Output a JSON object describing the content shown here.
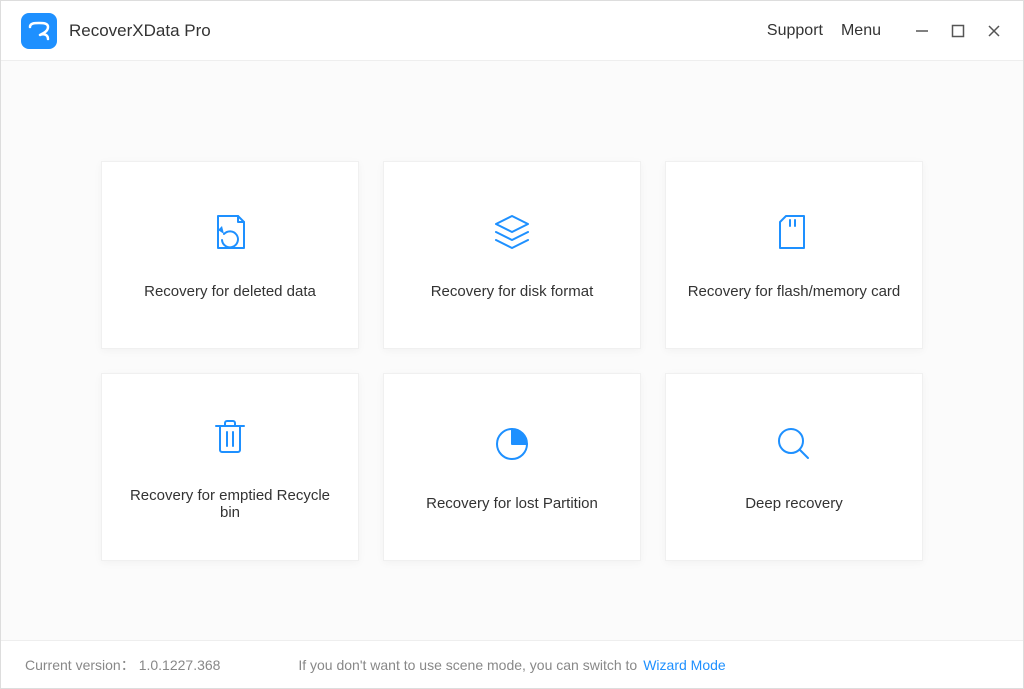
{
  "app": {
    "title": "RecoverXData Pro"
  },
  "header": {
    "support": "Support",
    "menu": "Menu"
  },
  "cards": [
    {
      "id": "deleted-data",
      "label": "Recovery for deleted data",
      "icon": "restore-file-icon"
    },
    {
      "id": "disk-format",
      "label": "Recovery for disk format",
      "icon": "layers-icon"
    },
    {
      "id": "flash-memory",
      "label": "Recovery for flash/memory card",
      "icon": "sd-card-icon"
    },
    {
      "id": "recycle-bin",
      "label": "Recovery for emptied Recycle bin",
      "icon": "trash-icon"
    },
    {
      "id": "lost-partition",
      "label": "Recovery for lost Partition",
      "icon": "pie-chart-icon"
    },
    {
      "id": "deep-recovery",
      "label": "Deep recovery",
      "icon": "magnifier-icon"
    }
  ],
  "footer": {
    "version_label": "Current version：",
    "version_value": "1.0.1227.368",
    "hint": "If you don't want to use scene mode, you can switch to",
    "wizard_link": "Wizard Mode"
  }
}
